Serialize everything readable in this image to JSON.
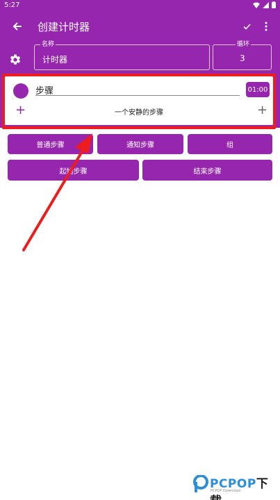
{
  "status": {
    "time": "5:27"
  },
  "toolbar": {
    "title": "创建计时器"
  },
  "form": {
    "name_label": "名称",
    "name_value": "计时器",
    "loop_label": "循环",
    "loop_value": "3"
  },
  "step": {
    "name": "步骤",
    "duration": "01:00",
    "sound": "一个安静的步骤"
  },
  "buttons": {
    "normal": "普通步骤",
    "notify": "通知步骤",
    "group": "组",
    "start": "起始步骤",
    "end": "结束步骤"
  },
  "watermark": {
    "brand": "PCPOP",
    "brand_cn": "下载",
    "sub": "PCPOP Download"
  },
  "colors": {
    "primary": "#9726ae",
    "highlight": "#ee1d1d",
    "watermark_blue": "#2a8fd6"
  }
}
